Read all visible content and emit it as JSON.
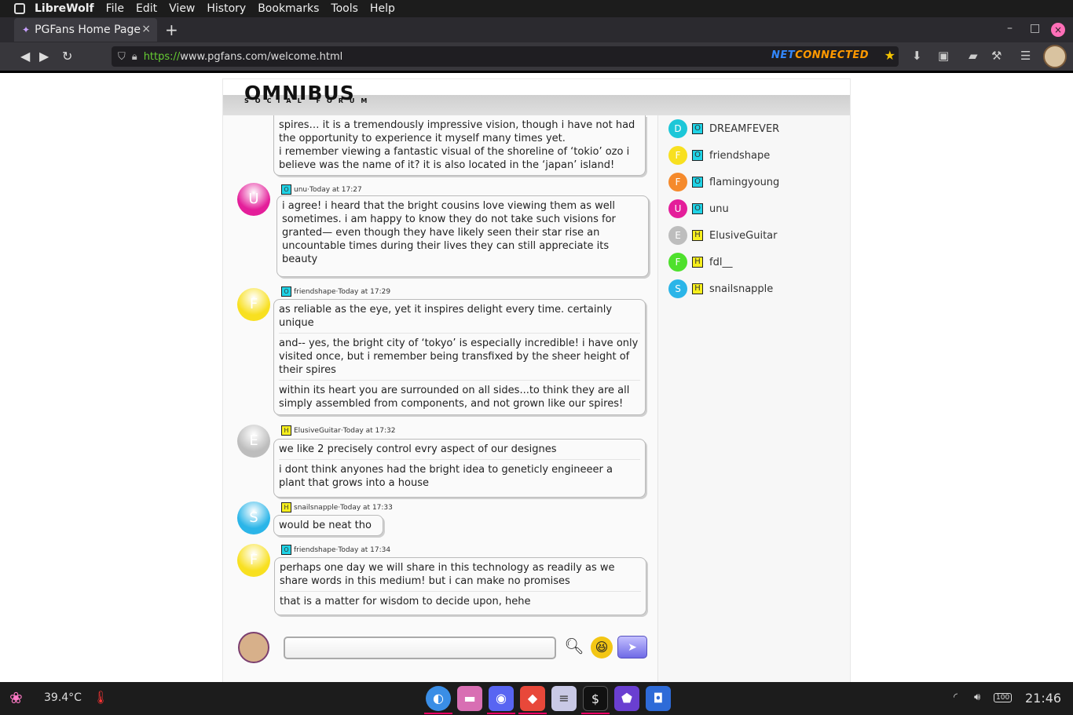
{
  "menubar": {
    "app": "LibreWolf",
    "items": [
      "File",
      "Edit",
      "View",
      "History",
      "Bookmarks",
      "Tools",
      "Help"
    ]
  },
  "tab": {
    "title": "PGFans Home Page",
    "close": "×",
    "new": "+"
  },
  "window": {
    "minimize": "–",
    "maximize": "□",
    "close": "×"
  },
  "url": {
    "protocol": "https://",
    "rest": "www.pgfans.com/welcome.html"
  },
  "netconnected": {
    "part1": "NET",
    "part2": "CONNECTED"
  },
  "site": {
    "logo": "OMNIBUS",
    "tagline": "SOCIAL FORUM"
  },
  "users": [
    {
      "initial": "D",
      "status": "O",
      "name": "DREAMFEVER",
      "color": "#1cc7d8"
    },
    {
      "initial": "F",
      "status": "O",
      "name": "friendshape",
      "color": "#f8e020"
    },
    {
      "initial": "F",
      "status": "O",
      "name": "flamingyoung",
      "color": "#f58a2c"
    },
    {
      "initial": "U",
      "status": "O",
      "name": "unu",
      "color": "#e41e9a"
    },
    {
      "initial": "E",
      "status": "H",
      "name": "ElusiveGuitar",
      "color": "#bdbdbd"
    },
    {
      "initial": "F",
      "status": "H",
      "name": "fdl__",
      "color": "#4ee02c"
    },
    {
      "initial": "S",
      "status": "H",
      "name": "snailsnapple",
      "color": "#2bb5e8"
    }
  ],
  "messages": [
    {
      "parts": [
        "spires… it is a tremendously impressive vision, though i have not had the opportunity to experience it myself many times yet.\ni remember viewing a fantastic visual of the shoreline of ‘tokio’ ozo i believe was the name of it? it is also located in the ‘japan’ island!"
      ]
    },
    {
      "initial": "U",
      "color": "#e41e9a",
      "status": "O",
      "author": "unu",
      "time": "Today at 17:27",
      "parts": [
        "i agree! i heard that the bright cousins love viewing them as well sometimes. i am happy to know they do not take such visions for granted— even though they have likely seen their star rise an uncountable times during their lives they can still appreciate its beauty"
      ]
    },
    {
      "initial": "F",
      "color": "#f8e020",
      "status": "O",
      "author": "friendshape",
      "time": "Today at 17:29",
      "parts": [
        "as reliable as the eye, yet it inspires delight every time. certainly unique",
        "and-- yes, the bright city of ‘tokyo’ is especially incredible! i have only visited once, but i remember being transfixed by the sheer height of their spires",
        "within its heart you are surrounded on all sides...to think they are all simply assembled from components, and not grown like our spires!"
      ]
    },
    {
      "initial": "E",
      "color": "#bdbdbd",
      "status": "H",
      "author": "ElusiveGuitar",
      "time": "Today at 17:32",
      "parts": [
        "we like 2 precisely control evry aspect of our designes",
        "i dont think anyones had the bright idea to geneticly engineeer a plant that grows into a house"
      ]
    },
    {
      "initial": "S",
      "color": "#2bb5e8",
      "status": "H",
      "author": "snailsnapple",
      "time": "Today at 17:33",
      "parts": [
        "would be neat tho"
      ]
    },
    {
      "initial": "F",
      "color": "#f8e020",
      "status": "O",
      "author": "friendshape",
      "time": "Today at 17:34",
      "parts": [
        "perhaps one day we will share in this technology as readily as we share words in this medium! but i can make no promises",
        "that is a matter for wisdom to decide upon, hehe"
      ]
    }
  ],
  "composer": {
    "value": "",
    "placeholder": ""
  },
  "taskbar": {
    "temperature": "39.4°C",
    "time": "21:46",
    "battery": "100"
  },
  "sep": " · "
}
